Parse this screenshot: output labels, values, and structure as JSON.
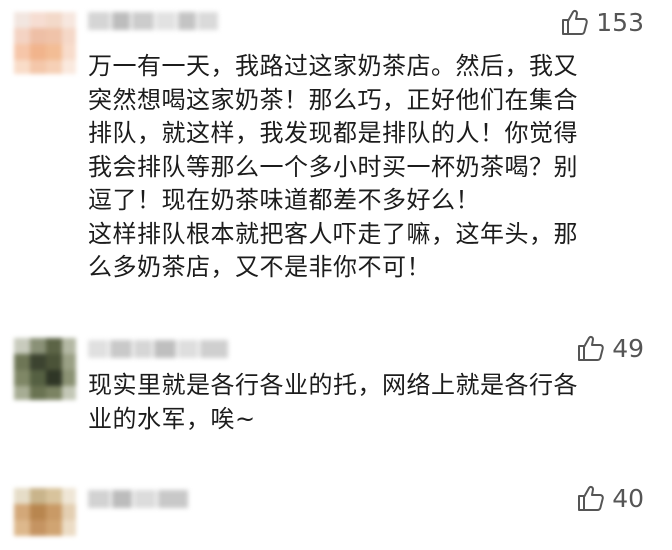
{
  "comments": [
    {
      "likes": "153",
      "lines": [
        "万一有一天，我路过这家奶茶店。然后，我又",
        "突然想喝这家奶茶！那么巧，正好他们在集合",
        "排队，就这样，我发现都是排队的人！你觉得",
        "我会排队等那么一个多小时买一杯奶茶喝？别",
        "逗了！现在奶茶味道都差不多好么！",
        "这样排队根本就把客人吓走了嘛，这年头，那",
        "么多奶茶店，又不是非你不可！"
      ]
    },
    {
      "likes": "49",
      "lines": [
        "现实里就是各行各业的托，网络上就是各行各",
        "业的水军，唉~"
      ]
    },
    {
      "likes": "40",
      "lines": []
    }
  ],
  "icons": {
    "like": "thumbs-up-outline-icon"
  },
  "colors": {
    "text": "#1c1c1c",
    "likes": "#555555",
    "background": "#ffffff"
  }
}
